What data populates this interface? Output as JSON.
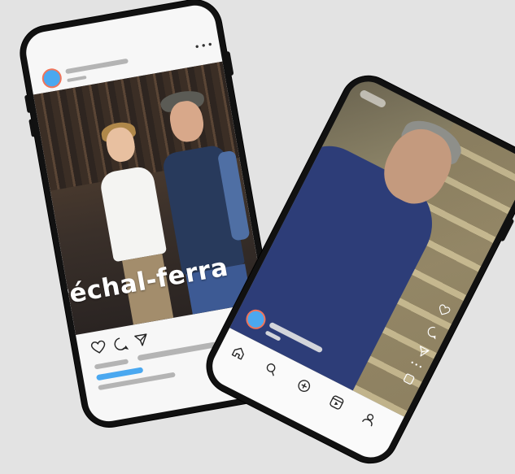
{
  "feed_post": {
    "overlay_text": "aréchal-ferra",
    "menu_icon": "more-dots-icon",
    "action_icons": [
      "heart-icon",
      "comment-icon",
      "share-icon"
    ],
    "avatar_color": "#4aa8f0",
    "avatar_ring_color": "#f0745a",
    "accent_bar_color": "#4aa8f0"
  },
  "reel": {
    "side_icons": [
      "heart-icon",
      "comment-icon",
      "share-icon",
      "more-dots-icon",
      "square-icon"
    ],
    "nav_icons": [
      "home-icon",
      "search-icon",
      "add-icon",
      "reels-icon",
      "profile-icon"
    ],
    "avatar_color": "#4aa8f0"
  }
}
